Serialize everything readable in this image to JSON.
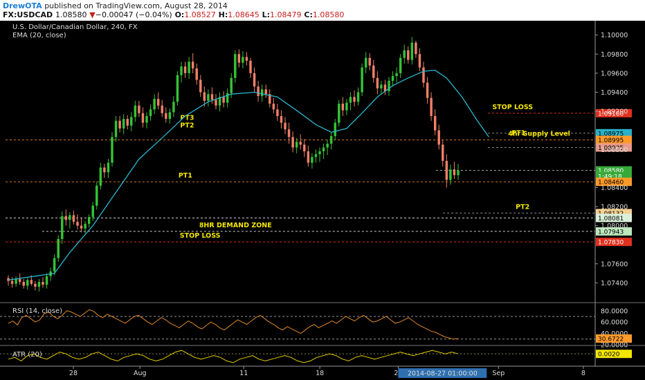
{
  "header": {
    "author": "DrewOTA",
    "published": "published on TradingView.com, August 28, 2014",
    "symbol": "FX:USDCAD",
    "last": "1.08580",
    "change_arrow": "▼",
    "change": "−0.00047 (−0.04%)",
    "o_label": "O:",
    "o_value": "1.08527",
    "h_label": "H:",
    "h_value": "1.08645",
    "l_label": "L:",
    "l_value": "1.08479",
    "c_label": "C:",
    "c_value": "1.08580"
  },
  "chart_data": {
    "type": "candlestick",
    "title": "U.S. Dollar/Canadian Dollar, 240, FX",
    "indicator_label": "EMA (20, close)",
    "ylim": [
      1.072,
      1.1015
    ],
    "y_ticks": [
      "1.10000",
      "1.09800",
      "1.09600",
      "1.09400",
      "1.09200",
      "1.08800",
      "1.08400",
      "1.08200",
      "1.08000",
      "1.07600",
      "1.07400"
    ],
    "x_ticks": [
      {
        "label": "28",
        "pos": 0.115
      },
      {
        "label": "Aug",
        "pos": 0.228
      },
      {
        "label": "11",
        "pos": 0.404
      },
      {
        "label": "18",
        "pos": 0.533
      },
      {
        "label": "25",
        "pos": 0.666
      },
      {
        "label": "Sep",
        "pos": 0.836
      },
      {
        "label": "8",
        "pos": 0.98
      }
    ],
    "x_cursor_label": "2014-08-27 01:00:00",
    "x_cursor_pos": 0.741,
    "candles": [
      [
        1.0745,
        1.0748,
        1.0737,
        1.0742
      ],
      [
        1.0742,
        1.0746,
        1.0735,
        1.0739
      ],
      [
        1.0739,
        1.0747,
        1.0736,
        1.0744
      ],
      [
        1.0744,
        1.075,
        1.0738,
        1.0741
      ],
      [
        1.0741,
        1.0744,
        1.0734,
        1.0737
      ],
      [
        1.0737,
        1.0745,
        1.0733,
        1.0743
      ],
      [
        1.0743,
        1.0748,
        1.0737,
        1.0739
      ],
      [
        1.0739,
        1.0742,
        1.0732,
        1.0736
      ],
      [
        1.0736,
        1.0744,
        1.0731,
        1.0741
      ],
      [
        1.0741,
        1.0746,
        1.0735,
        1.0738
      ],
      [
        1.0738,
        1.075,
        1.0734,
        1.0747
      ],
      [
        1.0747,
        1.0756,
        1.0742,
        1.0752
      ],
      [
        1.0752,
        1.077,
        1.0748,
        1.0766
      ],
      [
        1.0766,
        1.079,
        1.0762,
        1.0786
      ],
      [
        1.0786,
        1.0815,
        1.0781,
        1.081
      ],
      [
        1.081,
        1.0817,
        1.08,
        1.0806
      ],
      [
        1.0806,
        1.0814,
        1.0797,
        1.0811
      ],
      [
        1.0811,
        1.0816,
        1.0801,
        1.0804
      ],
      [
        1.0804,
        1.0812,
        1.0796,
        1.08
      ],
      [
        1.08,
        1.0808,
        1.0793,
        1.0797
      ],
      [
        1.0797,
        1.0805,
        1.0792,
        1.0802
      ],
      [
        1.0802,
        1.0812,
        1.0798,
        1.0809
      ],
      [
        1.0809,
        1.0825,
        1.0805,
        1.0821
      ],
      [
        1.0821,
        1.0846,
        1.0817,
        1.0842
      ],
      [
        1.0842,
        1.0866,
        1.0838,
        1.0861
      ],
      [
        1.0861,
        1.0865,
        1.085,
        1.0856
      ],
      [
        1.0856,
        1.087,
        1.085,
        1.0866
      ],
      [
        1.0866,
        1.0898,
        1.0862,
        1.0893
      ],
      [
        1.0893,
        1.0915,
        1.0888,
        1.091
      ],
      [
        1.091,
        1.0915,
        1.0898,
        1.0902
      ],
      [
        1.0902,
        1.0917,
        1.0896,
        1.0912
      ],
      [
        1.0912,
        1.0916,
        1.0901,
        1.0905
      ],
      [
        1.0905,
        1.0919,
        1.0899,
        1.0914
      ],
      [
        1.0914,
        1.0931,
        1.0909,
        1.0926
      ],
      [
        1.0926,
        1.0931,
        1.0914,
        1.0918
      ],
      [
        1.0918,
        1.0924,
        1.0903,
        1.0908
      ],
      [
        1.0908,
        1.0919,
        1.0902,
        1.0915
      ],
      [
        1.0915,
        1.0927,
        1.091,
        1.0922
      ],
      [
        1.0922,
        1.0938,
        1.0917,
        1.0933
      ],
      [
        1.0933,
        1.094,
        1.0922,
        1.0926
      ],
      [
        1.0926,
        1.0932,
        1.0914,
        1.0918
      ],
      [
        1.0918,
        1.0924,
        1.0908,
        1.0912
      ],
      [
        1.0912,
        1.0923,
        1.0907,
        1.0919
      ],
      [
        1.0919,
        1.0936,
        1.0914,
        1.093
      ],
      [
        1.093,
        1.0962,
        1.0926,
        1.0958
      ],
      [
        1.0958,
        1.0972,
        1.095,
        1.0967
      ],
      [
        1.0967,
        1.0972,
        1.0955,
        1.096
      ],
      [
        1.096,
        1.0977,
        1.0954,
        1.0972
      ],
      [
        1.0972,
        1.0981,
        1.096,
        1.0965
      ],
      [
        1.0965,
        1.097,
        1.0948,
        1.0953
      ],
      [
        1.0953,
        1.0958,
        1.0935,
        1.094
      ],
      [
        1.094,
        1.0946,
        1.0925,
        1.0931
      ],
      [
        1.0931,
        1.0943,
        1.0925,
        1.0938
      ],
      [
        1.0938,
        1.0945,
        1.0928,
        1.0932
      ],
      [
        1.0932,
        1.0938,
        1.0922,
        1.0926
      ],
      [
        1.0926,
        1.094,
        1.092,
        1.0935
      ],
      [
        1.0935,
        1.0941,
        1.0924,
        1.0929
      ],
      [
        1.0929,
        1.0944,
        1.0924,
        1.0939
      ],
      [
        1.0939,
        1.096,
        1.0934,
        1.0955
      ],
      [
        1.0955,
        1.0984,
        1.095,
        1.098
      ],
      [
        1.098,
        1.0985,
        1.0966,
        1.0971
      ],
      [
        1.0971,
        1.0983,
        1.0965,
        1.0977
      ],
      [
        1.0977,
        1.0982,
        1.0968,
        1.0973
      ],
      [
        1.0973,
        1.0976,
        1.0955,
        1.096
      ],
      [
        1.096,
        1.0966,
        1.094,
        1.0946
      ],
      [
        1.0946,
        1.0952,
        1.093,
        1.0936
      ],
      [
        1.0936,
        1.0948,
        1.093,
        1.0943
      ],
      [
        1.0943,
        1.0948,
        1.0934,
        1.0938
      ],
      [
        1.0938,
        1.0943,
        1.0924,
        1.0928
      ],
      [
        1.0928,
        1.0934,
        1.0918,
        1.0922
      ],
      [
        1.0922,
        1.0928,
        1.091,
        1.0915
      ],
      [
        1.0915,
        1.0921,
        1.0902,
        1.0908
      ],
      [
        1.0908,
        1.0914,
        1.0896,
        1.0901
      ],
      [
        1.0901,
        1.0908,
        1.0886,
        1.0893
      ],
      [
        1.0893,
        1.0899,
        1.0877,
        1.0882
      ],
      [
        1.0882,
        1.0892,
        1.0876,
        1.0888
      ],
      [
        1.0888,
        1.0896,
        1.088,
        1.0885
      ],
      [
        1.0885,
        1.0891,
        1.0872,
        1.0878
      ],
      [
        1.0878,
        1.0884,
        1.0862,
        1.0866
      ],
      [
        1.0866,
        1.0876,
        1.086,
        1.0872
      ],
      [
        1.0872,
        1.088,
        1.0866,
        1.0875
      ],
      [
        1.0875,
        1.0882,
        1.0867,
        1.0878
      ],
      [
        1.0878,
        1.0886,
        1.087,
        1.0882
      ],
      [
        1.0882,
        1.089,
        1.0874,
        1.0886
      ],
      [
        1.0886,
        1.0898,
        1.088,
        1.0894
      ],
      [
        1.0894,
        1.0912,
        1.089,
        1.0908
      ],
      [
        1.0908,
        1.0932,
        1.0904,
        1.0928
      ],
      [
        1.0928,
        1.0935,
        1.0915,
        1.0921
      ],
      [
        1.0921,
        1.0933,
        1.0916,
        1.0929
      ],
      [
        1.0929,
        1.094,
        1.0921,
        1.0935
      ],
      [
        1.0935,
        1.0942,
        1.0925,
        1.093
      ],
      [
        1.093,
        1.0945,
        1.0926,
        1.094
      ],
      [
        1.094,
        1.097,
        1.0936,
        1.0966
      ],
      [
        1.0966,
        1.0982,
        1.096,
        1.0976
      ],
      [
        1.0976,
        1.0981,
        1.0963,
        1.0968
      ],
      [
        1.0968,
        1.0974,
        1.095,
        1.0955
      ],
      [
        1.0955,
        1.0962,
        1.0938,
        1.0944
      ],
      [
        1.0944,
        1.0952,
        1.0938,
        1.0948
      ],
      [
        1.0948,
        1.0953,
        1.0937,
        1.0941
      ],
      [
        1.0941,
        1.0956,
        1.0936,
        1.0952
      ],
      [
        1.0952,
        1.0962,
        1.0946,
        1.0957
      ],
      [
        1.0957,
        1.0966,
        1.095,
        1.096
      ],
      [
        1.096,
        1.098,
        1.0955,
        1.0976
      ],
      [
        1.0976,
        1.099,
        1.097,
        1.0984
      ],
      [
        1.0984,
        1.0988,
        1.097,
        1.0974
      ],
      [
        1.0974,
        1.0998,
        1.0969,
        1.0992
      ],
      [
        1.0992,
        1.0994,
        1.0976,
        1.098
      ],
      [
        1.098,
        1.0986,
        1.0962,
        1.0966
      ],
      [
        1.0966,
        1.0972,
        1.0945,
        1.095
      ],
      [
        1.095,
        1.0956,
        1.0928,
        1.0934
      ],
      [
        1.0934,
        1.094,
        1.091,
        1.0915
      ],
      [
        1.0915,
        1.0922,
        1.0895,
        1.09
      ],
      [
        1.09,
        1.0906,
        1.088,
        1.0885
      ],
      [
        1.0885,
        1.089,
        1.0862,
        1.0868
      ],
      [
        1.0868,
        1.0875,
        1.084,
        1.0848
      ],
      [
        1.0848,
        1.0864,
        1.0843,
        1.0859
      ],
      [
        1.0859,
        1.0867,
        1.0849,
        1.0853
      ],
      [
        1.0853,
        1.0865,
        1.0848,
        1.0858
      ]
    ],
    "ema": [
      [
        0,
        1.0743
      ],
      [
        12,
        1.075
      ],
      [
        16,
        1.0772
      ],
      [
        22,
        1.08
      ],
      [
        28,
        1.0835
      ],
      [
        34,
        1.087
      ],
      [
        40,
        1.0892
      ],
      [
        46,
        1.0915
      ],
      [
        52,
        1.093
      ],
      [
        58,
        1.0938
      ],
      [
        64,
        1.094
      ],
      [
        70,
        1.0935
      ],
      [
        76,
        1.0918
      ],
      [
        80,
        1.0906
      ],
      [
        84,
        1.0898
      ],
      [
        88,
        1.0902
      ],
      [
        92,
        1.0918
      ],
      [
        96,
        1.0935
      ],
      [
        100,
        1.0947
      ],
      [
        104,
        1.0955
      ],
      [
        108,
        1.0962
      ],
      [
        111,
        1.0963
      ],
      [
        114,
        1.0955
      ],
      [
        118,
        1.0935
      ],
      [
        122,
        1.091
      ],
      [
        125,
        1.0893
      ]
    ],
    "levels": [
      {
        "label": "STOP LOSS",
        "value": 1.0918,
        "line": "#e0301e",
        "tag": "1.09180",
        "tag_bg": "#e0301e",
        "tag_fg": "#ffffff",
        "x0": 0.818,
        "x1": 1.0,
        "text_pos": 0.86
      },
      {
        "label": "",
        "value": 1.0897,
        "line": "#8a8a8a",
        "tag": "1.08975",
        "tag_bg": "#2ab0c8",
        "tag_fg": "#000000",
        "x0": 0.818,
        "x1": 1.0
      },
      {
        "label": "4hr Supply Level",
        "value": 1.089,
        "line": "#d77a24",
        "tag": "1.08995",
        "tag_bg": "#ff9a2a",
        "tag_fg": "#000000",
        "x0": 0.0,
        "x1": 1.0,
        "text_pos": 0.905
      },
      {
        "label": "PT1",
        "value": 1.0882,
        "line": "#8a8a8a",
        "tag": "1.08935",
        "tag_bg": "#e89a8a",
        "tag_fg": "#000000",
        "x0": 0.818,
        "x1": 1.0,
        "text_pos": 0.87
      },
      {
        "label": "",
        "value": 1.0858,
        "line": "#aaaaaa",
        "tag": "1.08580",
        "tag_bg": "#38a838",
        "tag_fg": "#ffffff",
        "x0": 0.73,
        "x1": 1.0
      },
      {
        "label": "",
        "value": 1.0852,
        "line": "",
        "tag": "1:49:18",
        "tag_bg": "#38a838",
        "tag_fg": "#ffffff",
        "x0": 0.0,
        "x1": 0.0
      },
      {
        "label": "PT1",
        "value": 1.0846,
        "line": "#d77a24",
        "tag": "1.08460",
        "tag_bg": "#ff9a2a",
        "tag_fg": "#000000",
        "x0": 0.0,
        "x1": 1.0,
        "text_pos": 0.305
      },
      {
        "label": "PT2",
        "value": 1.08132,
        "line": "#8a8a8a",
        "tag": "1.08132",
        "tag_bg": "#f5d090",
        "tag_fg": "#000000",
        "x0": 0.742,
        "x1": 1.0,
        "text_pos": 0.877
      },
      {
        "label": "",
        "value": 1.08081,
        "line": "#cfcfcf",
        "tag": "1.08081",
        "tag_bg": "#d9f0d9",
        "tag_fg": "#000000",
        "x0": 0.0,
        "x1": 1.0
      },
      {
        "label": "8HR DEMAND ZONE",
        "value": 1.0794,
        "line": "#cfcfcf",
        "tag": "1.07943",
        "tag_bg": "#bde8bd",
        "tag_fg": "#000000",
        "x0": 0.062,
        "x1": 1.0,
        "text_pos": 0.39
      },
      {
        "label": "STOP LOSS",
        "value": 1.0783,
        "line": "#e0301e",
        "tag": "1.07830",
        "tag_bg": "#e0301e",
        "tag_fg": "#ffffff",
        "x0": 0.0,
        "x1": 1.0,
        "text_pos": 0.33
      }
    ],
    "annotations": [
      {
        "label": "PT3",
        "price": 1.0911,
        "pos": 0.308
      },
      {
        "label": "PT2",
        "price": 1.0903,
        "pos": 0.308
      }
    ],
    "rsi": {
      "label": "RSI (14, close)",
      "ylim": [
        20,
        92
      ],
      "ticks": [
        "80.0000",
        "60.0000",
        "40.0000",
        "20.0000"
      ],
      "ref_lines": [
        70,
        30
      ],
      "last_tag": "30.6722",
      "values": [
        58,
        62,
        55,
        68,
        72,
        66,
        60,
        64,
        75,
        78,
        70,
        66,
        72,
        80,
        78,
        74,
        70,
        76,
        82,
        79,
        72,
        68,
        74,
        70,
        66,
        62,
        58,
        64,
        70,
        72,
        66,
        60,
        56,
        62,
        68,
        64,
        58,
        54,
        50,
        56,
        62,
        58,
        52,
        48,
        54,
        60,
        56,
        50,
        46,
        52,
        58,
        64,
        60,
        56,
        62,
        68,
        72,
        66,
        60,
        56,
        50,
        46,
        52,
        48,
        44,
        40,
        46,
        52,
        56,
        50,
        54,
        58,
        62,
        58,
        64,
        70,
        66,
        62,
        68,
        72,
        66,
        60,
        62,
        66,
        70,
        64,
        58,
        60,
        64,
        68,
        62,
        56,
        52,
        48,
        44,
        42,
        38,
        34,
        32,
        30,
        31
      ]
    },
    "atr": {
      "label": "ATR (20)",
      "last_tag": "0.0020",
      "values": [
        0.0017,
        0.0018,
        0.0016,
        0.0019,
        0.002,
        0.0018,
        0.0017,
        0.0019,
        0.0021,
        0.002,
        0.0018,
        0.0017,
        0.0018,
        0.002,
        0.0021,
        0.0019,
        0.0017,
        0.0016,
        0.0018,
        0.0019,
        0.002,
        0.0019,
        0.0017,
        0.0016,
        0.0017,
        0.0019,
        0.0021,
        0.0022,
        0.002,
        0.0018,
        0.0017,
        0.0018,
        0.0019,
        0.0018,
        0.0016,
        0.0015,
        0.0017,
        0.0018,
        0.0019,
        0.0017,
        0.0016,
        0.0017,
        0.0018,
        0.0019,
        0.0018,
        0.0016,
        0.0015,
        0.0016,
        0.0018,
        0.0019,
        0.002,
        0.0019,
        0.0017,
        0.0016,
        0.0018,
        0.0019,
        0.0018,
        0.0017,
        0.0018,
        0.0019,
        0.002,
        0.0021,
        0.002,
        0.0019,
        0.002,
        0.0021,
        0.0022,
        0.0021,
        0.002,
        0.0021,
        0.002
      ]
    }
  }
}
